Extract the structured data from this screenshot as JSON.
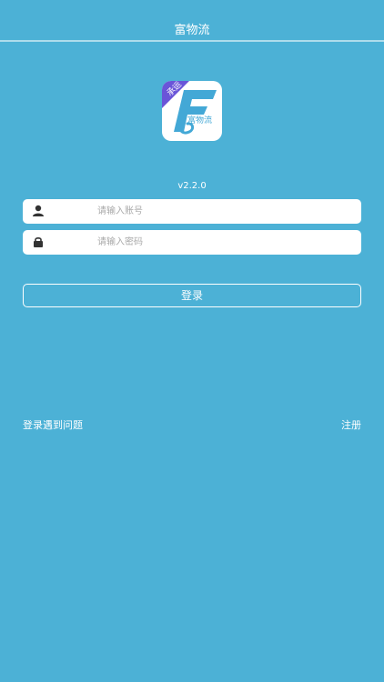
{
  "header": {
    "title": "富物流"
  },
  "logo": {
    "ribbon_text": "承运",
    "brand_text": "富物流",
    "colors": {
      "ribbon": "#6a55d8",
      "letter": "#43a8d6",
      "background": "#ffffff"
    }
  },
  "app": {
    "version": "v2.2.0"
  },
  "form": {
    "account": {
      "icon": "user-icon",
      "value": "",
      "placeholder": "请输入账号"
    },
    "password": {
      "icon": "lock-icon",
      "value": "",
      "placeholder": "请输入密码"
    },
    "login_label": "登录"
  },
  "footer": {
    "help_label": "登录遇到问题",
    "register_label": "注册"
  },
  "theme": {
    "background": "#4cb1d6",
    "text": "#ffffff"
  }
}
